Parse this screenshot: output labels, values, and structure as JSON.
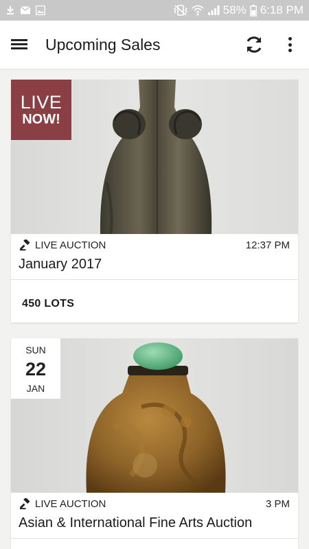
{
  "status_bar": {
    "battery_percent": "58%",
    "time": "6:18 PM",
    "left_icons": [
      "download-icon",
      "email-icon",
      "image-icon"
    ],
    "right_icons": [
      "vibrate-icon",
      "wifi-icon",
      "signal-icon",
      "battery-icon"
    ]
  },
  "app_bar": {
    "title": "Upcoming Sales",
    "menu_icon": "hamburger-menu-icon",
    "refresh_icon": "refresh-icon",
    "more_icon": "more-vertical-icon"
  },
  "sales": [
    {
      "badge_line1": "LIVE",
      "badge_line2": "NOW!",
      "type": "LIVE AUCTION",
      "time": "12:37 PM",
      "title": "January 2017",
      "lots": "450 LOTS",
      "badge_color": "#8a3f44"
    },
    {
      "day_of_week": "SUN",
      "day": "22",
      "month": "JAN",
      "type": "LIVE AUCTION",
      "time": "3 PM",
      "title": "Asian & International Fine Arts Auction"
    }
  ],
  "colors": {
    "status_bar": "#c8c8c8",
    "app_bar": "#ffffff",
    "background": "#f2f2f0",
    "live_badge": "#8a3f44"
  }
}
